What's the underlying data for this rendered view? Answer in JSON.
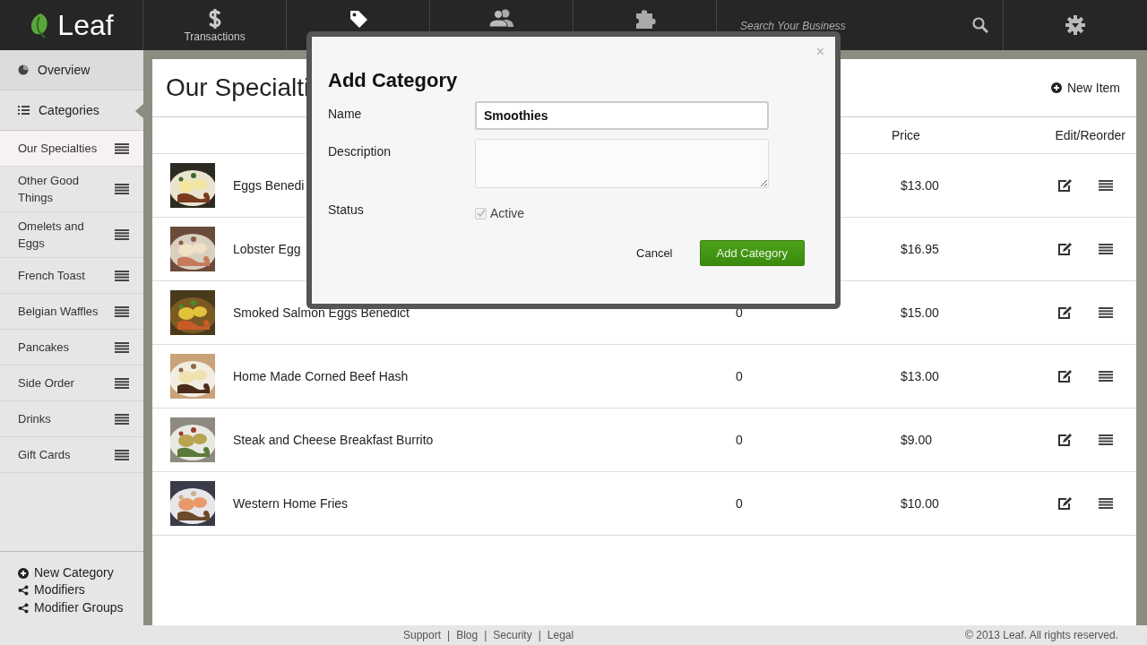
{
  "brand": {
    "name": "Leaf"
  },
  "nav": [
    {
      "kind": "dollar",
      "label": "Transactions"
    },
    {
      "kind": "tag"
    },
    {
      "kind": "people"
    },
    {
      "kind": "puzzle"
    }
  ],
  "search": {
    "placeholder": "Search Your Business"
  },
  "sidebar": {
    "sections": [
      {
        "label": "Overview",
        "selected": false
      },
      {
        "label": "Categories",
        "selected": true
      }
    ],
    "categories": [
      {
        "label": "Our Specialties",
        "selected": true
      },
      {
        "label": "Other Good Things",
        "selected": false
      },
      {
        "label": "Omelets and Eggs",
        "selected": false
      },
      {
        "label": "French Toast",
        "selected": false
      },
      {
        "label": "Belgian Waffles",
        "selected": false
      },
      {
        "label": "Pancakes",
        "selected": false
      },
      {
        "label": "Side Order",
        "selected": false
      },
      {
        "label": "Drinks",
        "selected": false
      },
      {
        "label": "Gift Cards",
        "selected": false
      }
    ],
    "actions": [
      {
        "kind": "add",
        "label": "New Category"
      },
      {
        "kind": "share",
        "label": "Modifiers"
      },
      {
        "kind": "share",
        "label": "Modifier Groups"
      }
    ]
  },
  "panel": {
    "title": "Our Specialti",
    "new_item": "New Item",
    "columns": {
      "price": "Price",
      "actions": "Edit/Reorder"
    },
    "rows": [
      {
        "name": "Eggs Benedi",
        "price": "$13.00"
      },
      {
        "name": "Lobster Egg",
        "price": "$16.95"
      },
      {
        "name": "Smoked Salmon Eggs Benedict",
        "quantity": "0",
        "price": "$15.00"
      },
      {
        "name": "Home Made Corned Beef Hash",
        "quantity": "0",
        "price": "$13.00"
      },
      {
        "name": "Steak and Cheese Breakfast Burrito",
        "quantity": "0",
        "price": "$9.00"
      },
      {
        "name": "Western Home Fries",
        "quantity": "0",
        "price": "$10.00"
      }
    ]
  },
  "dialog": {
    "title": "Add Category",
    "close": "×",
    "name": {
      "label": "Name",
      "value": "Smoothies"
    },
    "description": {
      "label": "Description"
    },
    "status": {
      "label": "Status",
      "option": "Active",
      "checked": true,
      "disabled": true
    },
    "cancel": "Cancel",
    "submit": "Add Category"
  },
  "footer": {
    "links": [
      "Support",
      "Blog",
      "Security",
      "Legal"
    ],
    "separator": "|",
    "copyright": "© 2013 Leaf. All rights reserved."
  }
}
